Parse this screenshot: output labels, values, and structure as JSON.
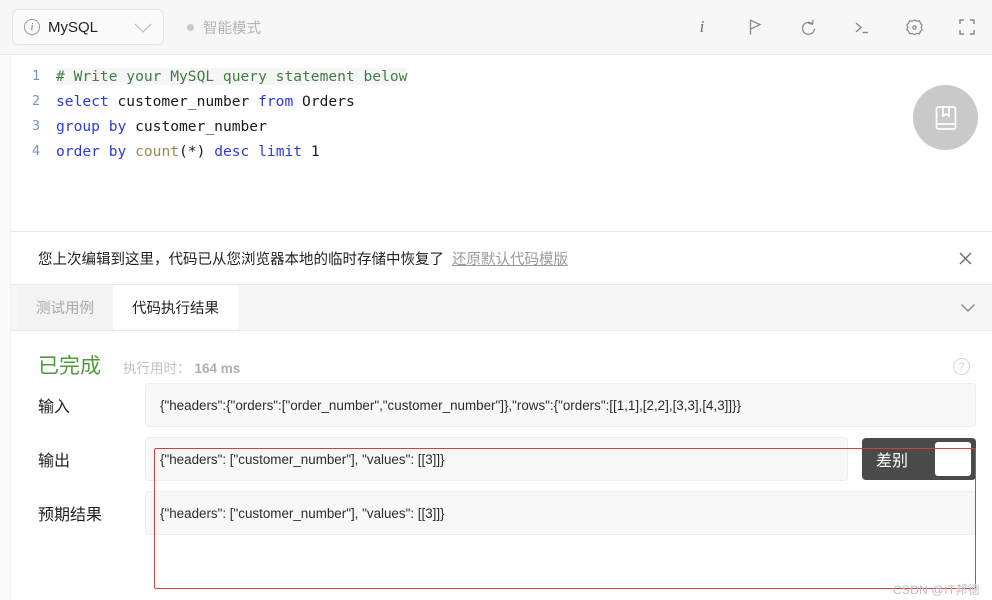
{
  "toolbar": {
    "language": "MySQL",
    "info_icon": "info-circle-icon",
    "dropdown_icon": "chevron-down-icon",
    "smart_mode_label": "智能模式",
    "icons": [
      {
        "name": "info-icon",
        "glyph": "i"
      },
      {
        "name": "flag-icon",
        "glyph": "flag"
      },
      {
        "name": "reset-icon",
        "glyph": "undo"
      },
      {
        "name": "console-icon",
        "glyph": ">_"
      },
      {
        "name": "settings-icon",
        "glyph": "gear"
      },
      {
        "name": "fullscreen-icon",
        "glyph": "expand"
      }
    ]
  },
  "editor": {
    "bookmark_icon": "notebook-icon",
    "lines": [
      {
        "number": "1",
        "tokens": [
          {
            "text": "# Write your MySQL query statement below",
            "type": "comment"
          }
        ]
      },
      {
        "number": "2",
        "tokens": [
          {
            "text": "select",
            "type": "kw"
          },
          {
            "text": " customer_number ",
            "type": "id"
          },
          {
            "text": "from",
            "type": "kw"
          },
          {
            "text": " Orders",
            "type": "id"
          }
        ]
      },
      {
        "number": "3",
        "tokens": [
          {
            "text": "group by",
            "type": "kw"
          },
          {
            "text": " customer_number",
            "type": "id"
          }
        ]
      },
      {
        "number": "4",
        "tokens": [
          {
            "text": "order by",
            "type": "kw"
          },
          {
            "text": " ",
            "type": "id"
          },
          {
            "text": "count",
            "type": "fn"
          },
          {
            "text": "(*) ",
            "type": "id"
          },
          {
            "text": "desc limit",
            "type": "kw"
          },
          {
            "text": " 1",
            "type": "num"
          }
        ]
      }
    ]
  },
  "notice": {
    "message": "您上次编辑到这里，代码已从您浏览器本地的临时存储中恢复了",
    "link_label": "还原默认代码模版",
    "close_icon": "close-icon"
  },
  "tabs": {
    "items": [
      {
        "label": "测试用例",
        "active": false
      },
      {
        "label": "代码执行结果",
        "active": true
      }
    ],
    "collapse_icon": "chevron-down-icon"
  },
  "results": {
    "status": "已完成",
    "status_color": "#4f9a3f",
    "runtime_label": "执行用时：",
    "runtime_value": "164 ms",
    "help_icon": "question-circle-icon",
    "rows": [
      {
        "label": "输入",
        "value": "{\"headers\":{\"orders\":[\"order_number\",\"customer_number\"]},\"rows\":{\"orders\":[[1,1],[2,2],[3,3],[4,3]]}}"
      },
      {
        "label": "输出",
        "value": "{\"headers\": [\"customer_number\"], \"values\": [[3]]}"
      },
      {
        "label": "预期结果",
        "value": "{\"headers\": [\"customer_number\"], \"values\": [[3]]}"
      }
    ],
    "diff_toggle_label": "差别",
    "highlight_color": "#d24040"
  },
  "watermark": "CSDN @IT邦德"
}
